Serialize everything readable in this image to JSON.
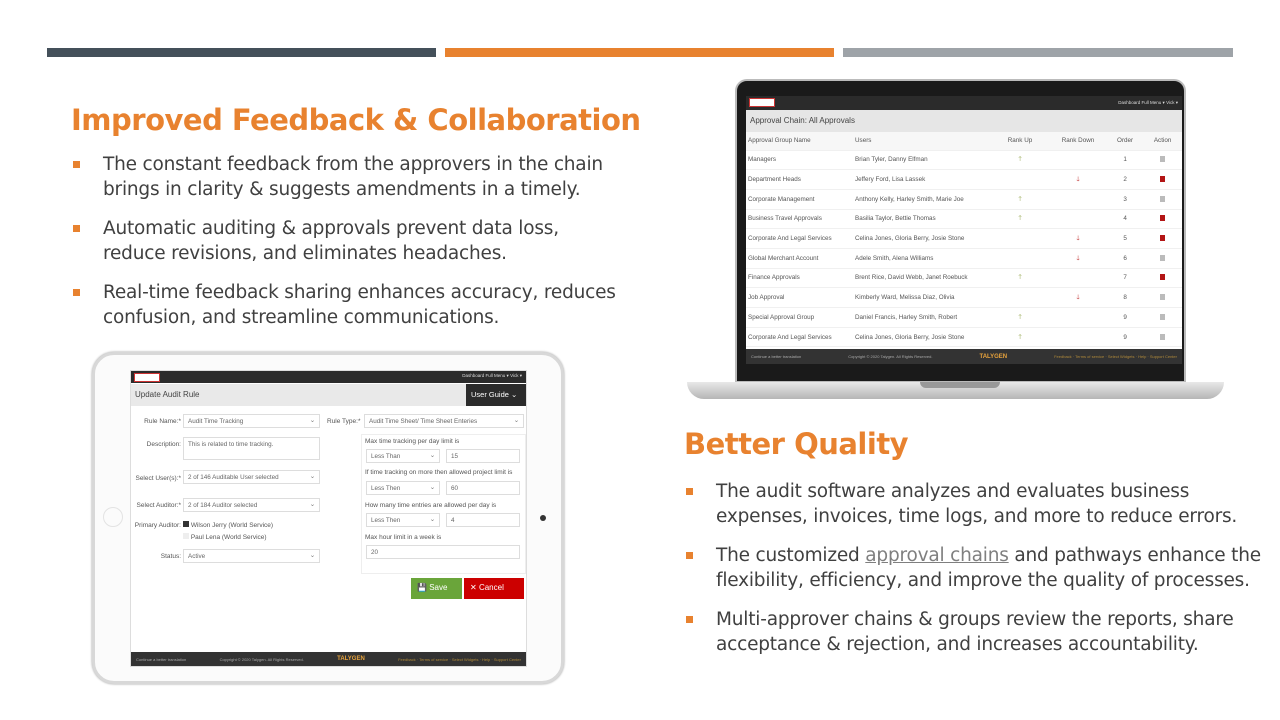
{
  "colors": {
    "dark": "#44505a",
    "accent": "#e8822f",
    "gray": "#9ea3a8"
  },
  "left": {
    "heading": "Improved Feedback & Collaboration",
    "bullets": [
      "The constant feedback from the approvers in the chain brings in clarity & suggests amendments in a timely.",
      "Automatic auditing & approvals prevent data loss, reduce revisions, and eliminates headaches.",
      "Real-time feedback sharing enhances accuracy, reduces confusion, and streamline communications."
    ]
  },
  "right": {
    "heading": "Better Quality",
    "bullets": [
      {
        "pre": "The audit software analyzes and evaluates business expenses, invoices, time logs, and more to reduce errors.",
        "link": "",
        "post": ""
      },
      {
        "pre": "The customized ",
        "link": "approval chains",
        "post": " and pathways enhance the flexibility, efficiency, and improve the quality of processes."
      },
      {
        "pre": "Multi-approver chains & groups review the reports, share acceptance & rejection, and increases accountability.",
        "link": "",
        "post": ""
      }
    ]
  },
  "app": {
    "nav": "Dashboard   Full Menu ▾   Vick ▾",
    "footer_left": "Continue a better translation",
    "footer_copy": "Copyright © 2020 Talygen. All Rights Reserved.",
    "footer_brand": "TALYGEN",
    "footer_links": "Feedback · Terms of service · Select Widgets · Help · Support Center"
  },
  "audit_form": {
    "title": "Update Audit Rule",
    "user_guide": "User Guide",
    "rule_name_label": "Rule Name:*",
    "rule_name": "Audit Time Tracking",
    "description_label": "Description:",
    "description": "This is related to time tracking.",
    "users_label": "Select User(s):*",
    "users": "2 of 146 Auditable User selected",
    "auditor_label": "Select Auditor:*",
    "auditor": "2 of 184 Auditor selected",
    "primary_label": "Primary Auditor:",
    "primary_options": [
      "Wilson Jerry (World Service)",
      "Paul Lena (World Service)"
    ],
    "status_label": "Status:",
    "status": "Active",
    "rule_type_label": "Rule Type:*",
    "rule_type": "Audit Time Sheet/ Time Sheet Enteries",
    "conditions": [
      {
        "label": "Max time tracking per day limit is",
        "op": "Less Than",
        "value": "15"
      },
      {
        "label": "If time tracking on more then allowed project limit is",
        "op": "Less Then",
        "value": "60"
      },
      {
        "label": "How many time entries are allowed per day is",
        "op": "Less Then",
        "value": "4"
      }
    ],
    "weekly_label": "Max hour limit in a week is",
    "weekly_value": "20",
    "save": "Save",
    "cancel": "Cancel"
  },
  "approval_chain": {
    "title": "Approval Chain: All Approvals",
    "columns": [
      "Approval Group Name",
      "Users",
      "Rank Up",
      "Rank Down",
      "Order",
      "Action"
    ],
    "rows": [
      {
        "name": "Managers",
        "users": "Brian Tyler, Danny Elfman",
        "up": true,
        "down": false,
        "order": "1",
        "delete_active": false
      },
      {
        "name": "Department Heads",
        "users": "Jeffery Ford, Lisa Lassek",
        "up": false,
        "down": true,
        "order": "2",
        "delete_active": true
      },
      {
        "name": "Corporate Management",
        "users": "Anthony Kelly, Harley Smith, Marie Joe",
        "up": true,
        "down": false,
        "order": "3",
        "delete_active": false
      },
      {
        "name": "Business Travel Approvals",
        "users": "Basilia Taylor, Bettie Thomas",
        "up": true,
        "down": false,
        "order": "4",
        "delete_active": true
      },
      {
        "name": "Corporate And Legal Services",
        "users": "Celina Jones, Gloria Berry, Josie Stone",
        "up": false,
        "down": true,
        "order": "5",
        "delete_active": true
      },
      {
        "name": "Global Merchant Account",
        "users": "Adele Smith, Alena Williams",
        "up": false,
        "down": true,
        "order": "6",
        "delete_active": false
      },
      {
        "name": "Finance Approvals",
        "users": "Brent Rice, David Webb, Janet Roebuck",
        "up": true,
        "down": false,
        "order": "7",
        "delete_active": true
      },
      {
        "name": "Job Approval",
        "users": "Kimberly Ward, Melissa Diaz, Olivia",
        "up": false,
        "down": true,
        "order": "8",
        "delete_active": false
      },
      {
        "name": "Special Approval Group",
        "users": "Daniel Francis, Harley Smith, Robert",
        "up": true,
        "down": false,
        "order": "9",
        "delete_active": false
      },
      {
        "name": "Corporate And Legal Services",
        "users": "Celina Jones, Gloria Berry, Josie Stone",
        "up": true,
        "down": false,
        "order": "9",
        "delete_active": false
      }
    ]
  }
}
